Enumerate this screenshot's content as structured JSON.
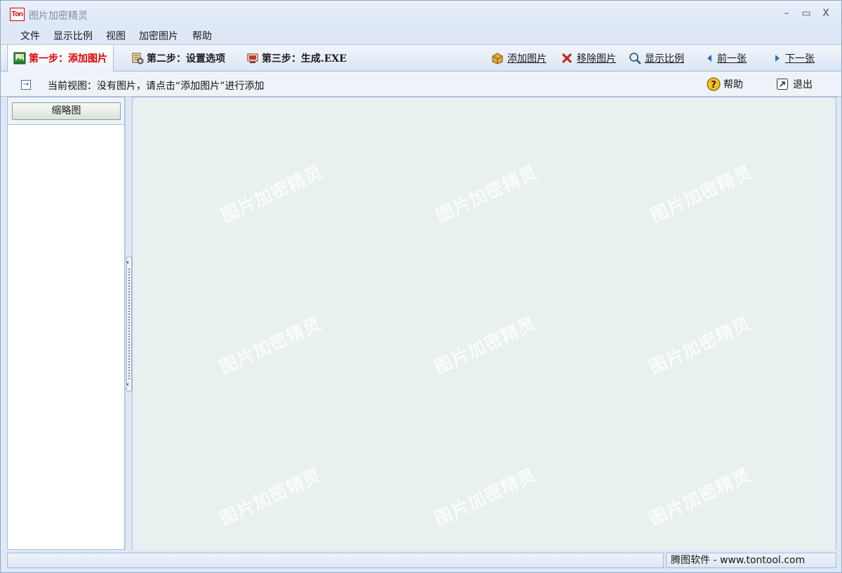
{
  "window": {
    "title": "图片加密精灵",
    "app_icon_text": "Ton",
    "controls": {
      "minimize": "–",
      "maximize": "▭",
      "close": "X"
    }
  },
  "menu": {
    "items": [
      "文件",
      "显示比例",
      "视图",
      "加密图片",
      "帮助"
    ]
  },
  "toolbar": {
    "steps": [
      "第一步：添加图片",
      "第二步：设置选项",
      "第三步：生成.EXE"
    ],
    "active_step": 0,
    "actions": [
      "添加图片",
      "移除图片",
      "显示比例",
      "前一张",
      "下一张"
    ]
  },
  "status_row": {
    "current_view": "当前视图：没有图片，请点击“添加图片”进行添加",
    "help": "帮助",
    "exit": "退出"
  },
  "left_panel": {
    "thumbnail_button": "缩略图"
  },
  "main_view": {
    "watermark": "图片加密精灵"
  },
  "statusbar": {
    "left_text": "",
    "right_text": "腾图软件 - www.tontool.com"
  },
  "colors": {
    "active_step": "#e00000",
    "main_bg": "#e9f1f0",
    "chrome_bg": "#dfe8f6"
  }
}
